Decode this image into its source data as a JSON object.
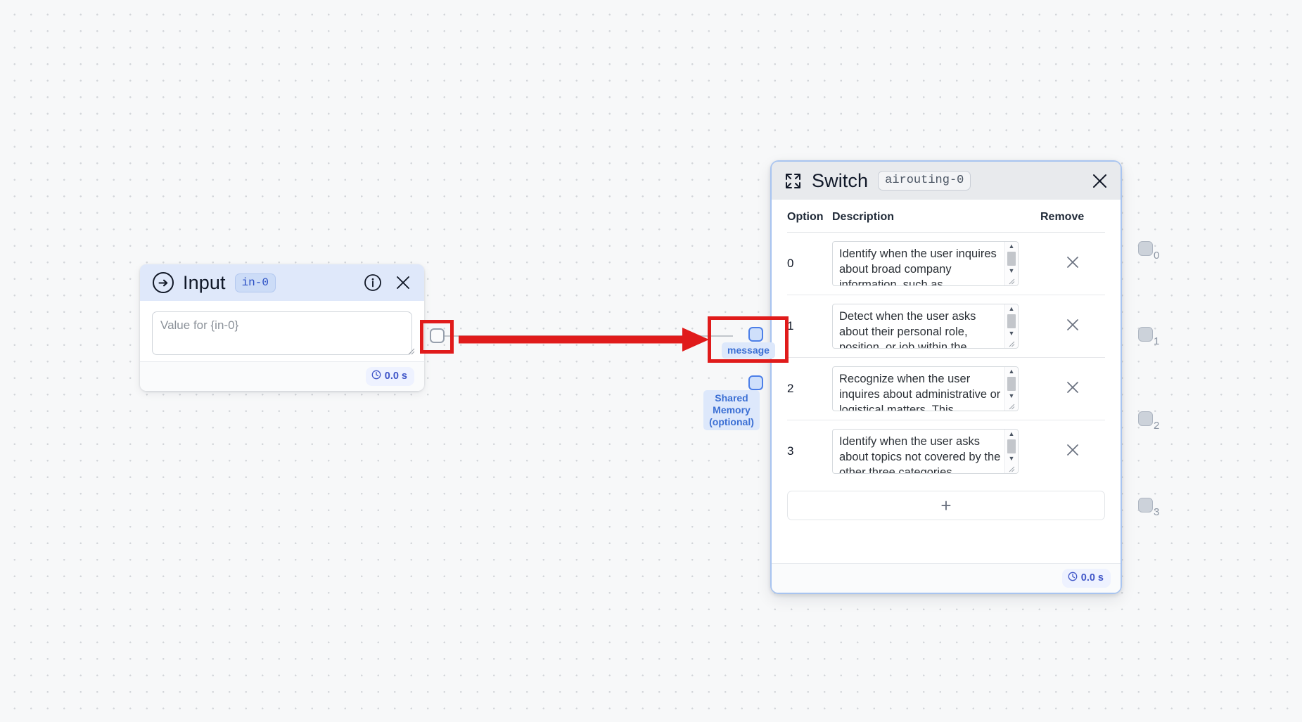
{
  "canvas": {
    "background_color": "#f7f8f9",
    "dot_color": "#d3d6da"
  },
  "input_node": {
    "title": "Input",
    "badge": "in-0",
    "header_color": "#dfe8fa",
    "icons": {
      "arrow": "arrow-right-circle-icon",
      "info": "info-icon",
      "close": "close-icon"
    },
    "value_field": {
      "placeholder": "Value for {in-0}",
      "value": ""
    },
    "footer": {
      "time": "0.0 s",
      "clock_icon": "clock-icon"
    },
    "output_handle": {
      "name": "output-handle",
      "color": "#97a0ad"
    }
  },
  "switch_node": {
    "title": "Switch",
    "badge": "airouting-0",
    "header_color": "#e8eaed",
    "border_color": "#a8c4f0",
    "icons": {
      "expand": "expand-icon",
      "close": "close-icon"
    },
    "table": {
      "headers": [
        "Option",
        "Description",
        "Remove"
      ],
      "rows": [
        {
          "option": "0",
          "description": "Identify when the user inquires about broad company information, such as",
          "remove_icon": "close-icon"
        },
        {
          "option": "1",
          "description": "Detect when the user asks about their personal role, position, or job within the",
          "remove_icon": "close-icon"
        },
        {
          "option": "2",
          "description": "Recognize when the user inquires about administrative or logistical matters. This",
          "remove_icon": "close-icon"
        },
        {
          "option": "3",
          "description": "Identify when the user asks about topics not covered by the other three categories,",
          "remove_icon": "close-icon"
        }
      ]
    },
    "add_row_label": "+",
    "footer": {
      "time": "0.0 s",
      "clock_icon": "clock-icon"
    },
    "input_handles": [
      {
        "label": "message",
        "color": "#4c7fe8"
      },
      {
        "label": "Shared Memory (optional)",
        "color": "#4c7fe8"
      }
    ],
    "output_handles": [
      {
        "label": "0"
      },
      {
        "label": "1"
      },
      {
        "label": "2"
      },
      {
        "label": "3"
      }
    ]
  },
  "annotations": {
    "highlight_color": "#e01b1b",
    "arrow": "red-arrow-right",
    "boxes": [
      "input-output-handle-highlight",
      "message-handle-highlight"
    ]
  }
}
